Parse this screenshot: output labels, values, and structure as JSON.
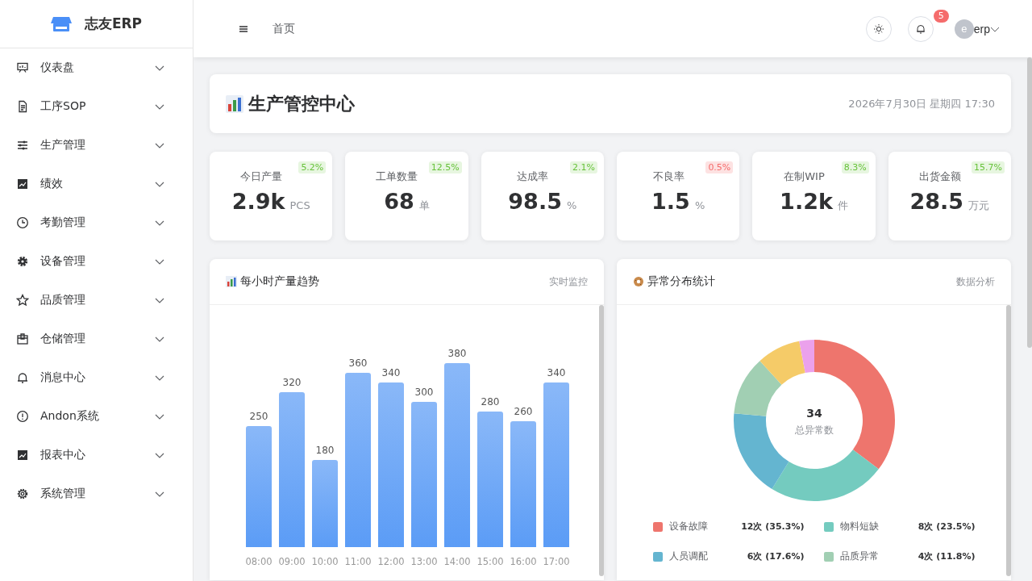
{
  "sidebar": {
    "brand": "志友ERP",
    "items": [
      {
        "label": "仪表盘",
        "expanded": false
      },
      {
        "label": "工序SOP",
        "expanded": false
      },
      {
        "label": "生产管理",
        "expanded": false
      },
      {
        "label": "绩效",
        "expanded": false
      },
      {
        "label": "考勤管理",
        "expanded": false
      },
      {
        "label": "设备管理",
        "expanded": false
      },
      {
        "label": "品质管理",
        "expanded": false
      },
      {
        "label": "仓储管理",
        "expanded": false
      },
      {
        "label": "消息中心",
        "expanded": false
      },
      {
        "label": "Andon系统",
        "expanded": false
      },
      {
        "label": "报表中心",
        "expanded": false
      },
      {
        "label": "系统管理",
        "expanded": false
      }
    ]
  },
  "header": {
    "breadcrumb": "首页",
    "notification_count": "5",
    "avatar_letter": "e",
    "user": "erp"
  },
  "title_card": {
    "title": "生产管控中心",
    "datetime": "2026年7月30日 星期四 17:30"
  },
  "kpis": [
    {
      "label": "今日产量",
      "value": "2.9k",
      "unit": "PCS",
      "change": "5.2%",
      "negative": false
    },
    {
      "label": "工单数量",
      "value": "68",
      "unit": "单",
      "change": "12.5%",
      "negative": false
    },
    {
      "label": "达成率",
      "value": "98.5",
      "unit": "%",
      "change": "2.1%",
      "negative": false
    },
    {
      "label": "不良率",
      "value": "1.5",
      "unit": "%",
      "change": "0.5%",
      "negative": true
    },
    {
      "label": "在制WIP",
      "value": "1.2k",
      "unit": "件",
      "change": "8.3%",
      "negative": false
    },
    {
      "label": "出货金额",
      "value": "28.5",
      "unit": "万元",
      "change": "15.7%",
      "negative": false
    }
  ],
  "bar_panel": {
    "title": "每小时产量趋势",
    "tag": "实时监控",
    "chart_data": {
      "type": "bar",
      "categories": [
        "08:00",
        "09:00",
        "10:00",
        "11:00",
        "12:00",
        "13:00",
        "14:00",
        "15:00",
        "16:00",
        "17:00"
      ],
      "values": [
        250,
        320,
        180,
        360,
        340,
        300,
        380,
        280,
        260,
        340
      ],
      "data_labels": true
    }
  },
  "donut_panel": {
    "title": "异常分布统计",
    "tag": "数据分析",
    "center_value": "34",
    "center_label": "总异常数",
    "chart_data": {
      "type": "donut",
      "values": [
        35.3,
        23.5,
        17.6,
        11.8,
        8.8,
        3.0
      ]
    },
    "legend": [
      {
        "name": "设备故障",
        "count": "12次 (35.3%)",
        "color": "#ee756d"
      },
      {
        "name": "物料短缺",
        "count": "8次 (23.5%)",
        "color": "#74cbbf"
      },
      {
        "name": "人员调配",
        "count": "6次 (17.6%)",
        "color": "#64b5d0"
      },
      {
        "name": "品质异常",
        "count": "4次 (11.8%)",
        "color": "#a1cfb3"
      }
    ]
  }
}
